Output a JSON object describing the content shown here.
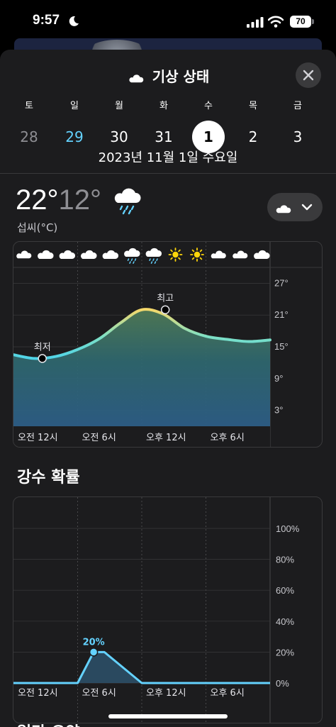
{
  "status_bar": {
    "time": "9:57",
    "battery": "70"
  },
  "sheet": {
    "title": "기상 상태"
  },
  "calendar": {
    "days": [
      {
        "letter": "토",
        "number": "28",
        "state": "past"
      },
      {
        "letter": "일",
        "number": "29",
        "state": "today"
      },
      {
        "letter": "월",
        "number": "30",
        "state": "normal"
      },
      {
        "letter": "화",
        "number": "31",
        "state": "normal"
      },
      {
        "letter": "수",
        "number": "1",
        "state": "selected"
      },
      {
        "letter": "목",
        "number": "2",
        "state": "normal"
      },
      {
        "letter": "금",
        "number": "3",
        "state": "normal"
      }
    ],
    "selected_date": "2023년 11월 1일 수요일"
  },
  "current": {
    "high": "22°",
    "low": "12°",
    "unit": "섭씨(°C)",
    "icon": "cloud-rain-icon"
  },
  "colors": {
    "accent": "#64d2ff",
    "sheet_bg": "#1c1c1e",
    "sun": "#ffd60a"
  },
  "chart_data": [
    {
      "type": "area",
      "hourly_icons": [
        "cloud-moon-icon",
        "cloud-icon",
        "cloud-icon",
        "cloud-icon",
        "cloud-icon",
        "cloud-rain-icon",
        "cloud-rain-icon",
        "sun-icon",
        "sun-icon",
        "cloud-moon-icon",
        "cloud-moon-icon",
        "cloud-icon"
      ],
      "x": [
        0,
        2,
        4,
        6,
        8,
        10,
        12,
        14,
        16,
        18,
        20,
        22,
        24
      ],
      "y": [
        13.5,
        12.8,
        13.2,
        14.5,
        16.5,
        19.5,
        22.0,
        21.2,
        18.5,
        17.0,
        16.4,
        16.0,
        16.3
      ],
      "y_ticks": [
        "27°",
        "21°",
        "15°",
        "9°",
        "3°"
      ],
      "y_tick_values": [
        27,
        21,
        15,
        9,
        3
      ],
      "ylim": [
        0,
        30
      ],
      "x_tick_labels": [
        "오전 12시",
        "오전 6시",
        "오후 12시",
        "오후 6시"
      ],
      "annotations": {
        "low_label": "최저",
        "low_x": 2.7,
        "low_y": 12.8,
        "high_label": "최고",
        "high_x": 14.2,
        "high_y": 22.0
      }
    },
    {
      "type": "area",
      "title": "강수 확률",
      "x": [
        0,
        6,
        7.5,
        8.5,
        12,
        24
      ],
      "y": [
        0,
        0,
        20,
        20,
        0,
        0
      ],
      "y_ticks": [
        "100%",
        "80%",
        "60%",
        "40%",
        "20%",
        "0%"
      ],
      "y_tick_values": [
        100,
        80,
        60,
        40,
        20,
        0
      ],
      "ylim": [
        0,
        100
      ],
      "x_tick_labels": [
        "오전 12시",
        "오전 6시",
        "오후 12시",
        "오후 6시"
      ],
      "annotations": {
        "peak_label": "20%",
        "peak_x": 7.5,
        "peak_y": 20
      }
    }
  ],
  "next_section": {
    "title": "일간 요약"
  }
}
